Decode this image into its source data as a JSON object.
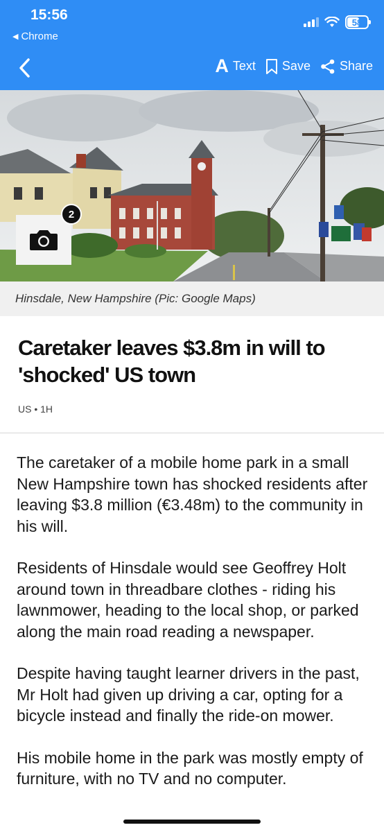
{
  "status_bar": {
    "time": "15:56",
    "back_app": "Chrome",
    "battery": "58",
    "icons": [
      "signal-icon",
      "wifi-icon",
      "battery-icon"
    ]
  },
  "toolbar": {
    "back_icon": "chevron-left-icon",
    "text_label": "Text",
    "text_glyph": "A",
    "save_label": "Save",
    "share_label": "Share"
  },
  "hero": {
    "photo_count": "2",
    "camera_icon": "camera-icon",
    "caption": "Hinsdale, New Hampshire (Pic: Google Maps)"
  },
  "article": {
    "title": "Caretaker leaves $3.8m in will to 'shocked' US town",
    "meta": "US • 1H",
    "paragraphs": [
      "The caretaker of a mobile home park in a small New Hampshire town has shocked residents after leaving $3.8 million (€3.48m) to the community in his will.",
      "Residents of Hinsdale would see Geoffrey Holt around town in threadbare clothes - riding his lawnmower, heading to the local shop, or parked along the main road reading a newspaper.",
      "Despite having taught learner drivers in the past, Mr Holt had given up driving a car, opting for a bicycle instead and finally the ride-on mower.",
      "His mobile home in the park was mostly empty of furniture, with no TV and no computer."
    ]
  },
  "colors": {
    "header_bg": "#2f8df5",
    "caption_bg": "#f0f0f0"
  }
}
